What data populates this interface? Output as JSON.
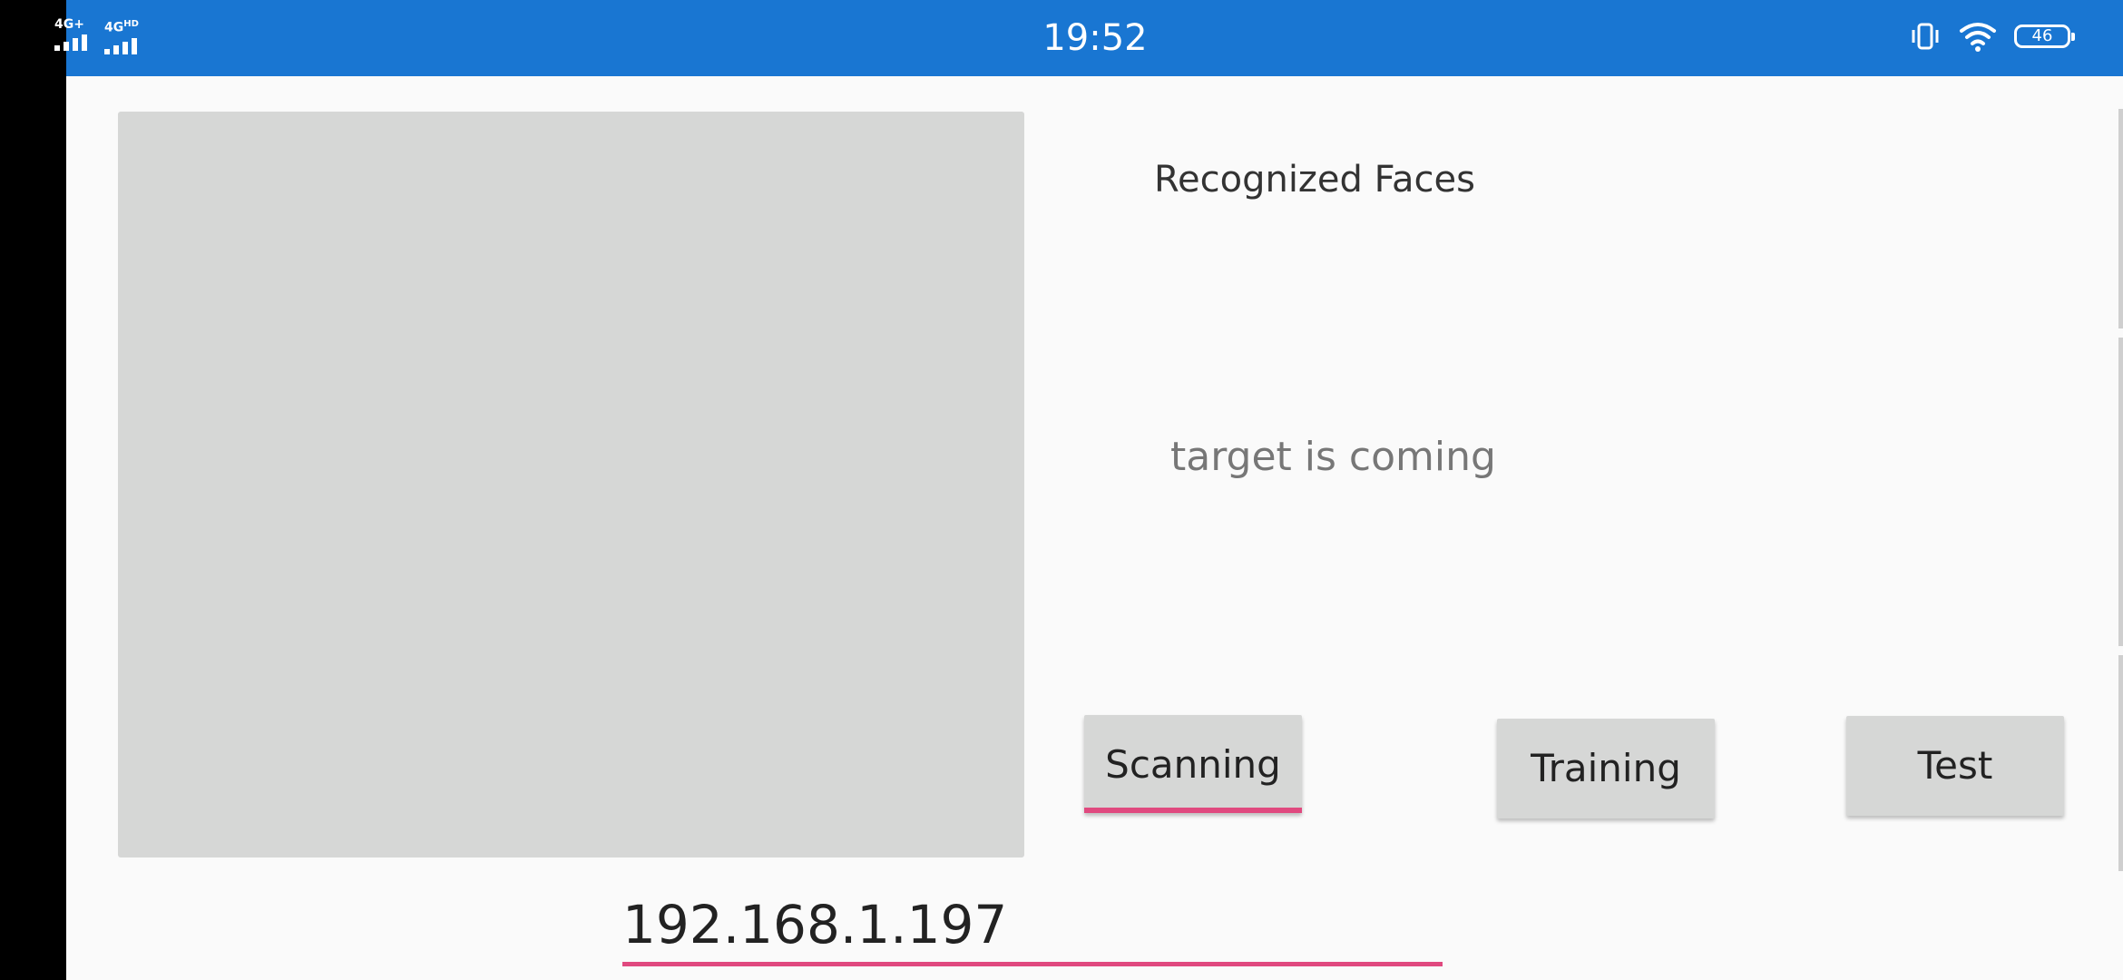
{
  "status_bar": {
    "time": "19:52",
    "signal_1_label": "4G+",
    "signal_2_label": "4G",
    "signal_2_sup": "HD",
    "battery_level": "46",
    "icons": [
      "signal-icon",
      "vibrate-icon",
      "wifi-icon",
      "battery-icon"
    ],
    "background_color": "#1976d2"
  },
  "main": {
    "preview_color": "#d6d7d6",
    "title": "Recognized Faces",
    "status_text": "target is coming"
  },
  "buttons": {
    "scanning_label": "Scanning",
    "training_label": "Training",
    "test_label": "Test",
    "active_button": "Scanning",
    "accent_color": "#e0497f"
  },
  "ip_field": {
    "value": "192.168.1.197"
  }
}
